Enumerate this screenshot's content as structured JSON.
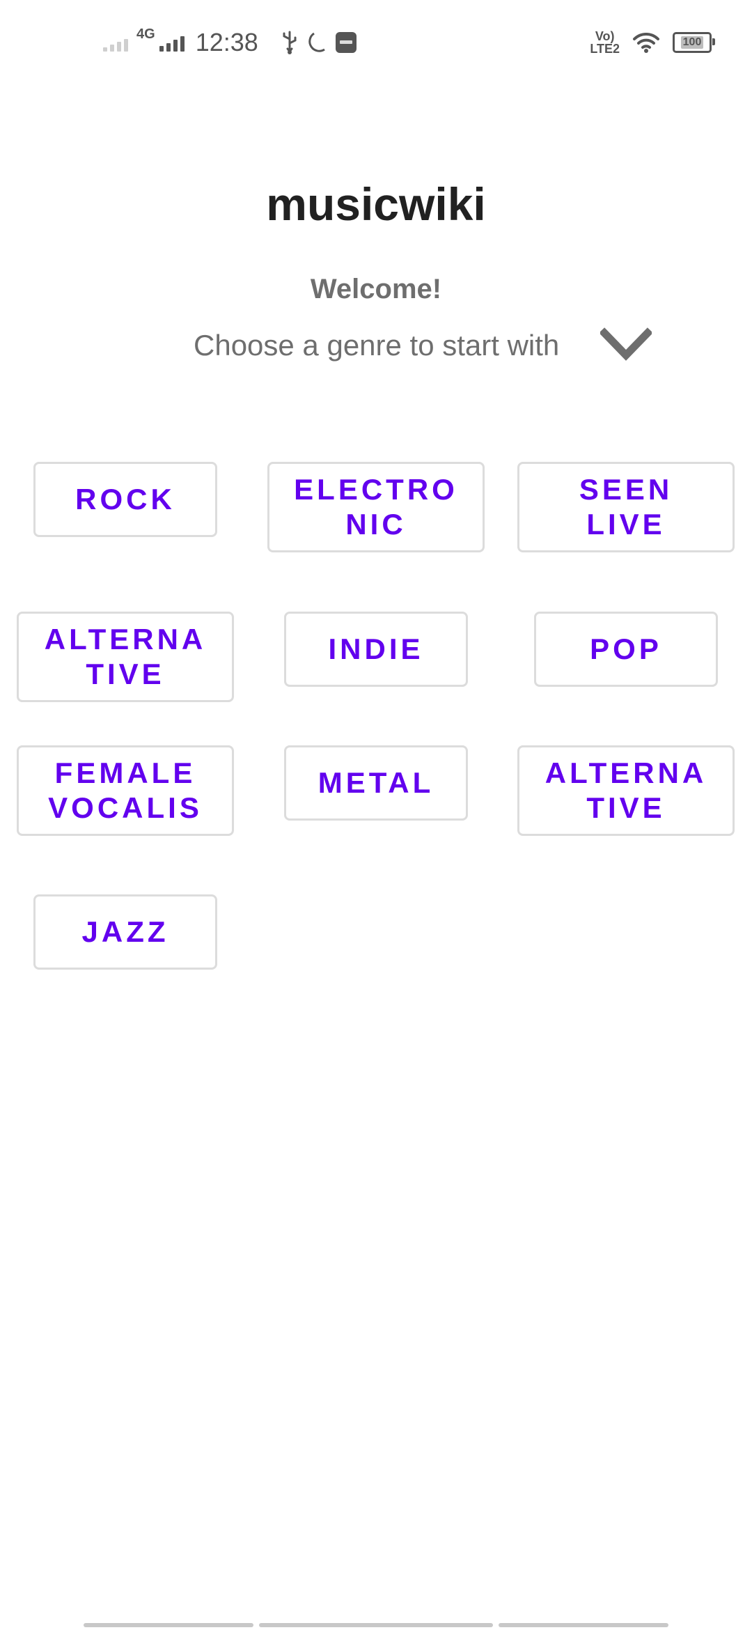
{
  "status_bar": {
    "network": "4G",
    "time": "12:38",
    "volte_line1": "Vo)",
    "volte_line2": "LTE2",
    "battery": "100",
    "icons": [
      "signal-weak-icon",
      "signal-4g-icon",
      "usb-icon",
      "do-not-disturb-moon-icon",
      "notification-app-icon",
      "volte-icon",
      "wifi-icon",
      "battery-icon"
    ]
  },
  "header": {
    "title": "musicwiki",
    "welcome": "Welcome!",
    "subtitle": "Choose a genre to start with",
    "expand_icon": "chevron-down-icon"
  },
  "genres": [
    "ROCK",
    "ELECTRO\nNIC",
    "SEEN\nLIVE",
    "ALTERNA\nTIVE",
    "INDIE",
    "POP",
    "FEMALE\nVOCALIS",
    "METAL",
    "ALTERNA\nTIVE",
    "JAZZ"
  ],
  "colors": {
    "accent": "#6200ee",
    "title": "#212121",
    "secondary_text": "#6e6e6e",
    "button_border": "#dcdcdc"
  }
}
